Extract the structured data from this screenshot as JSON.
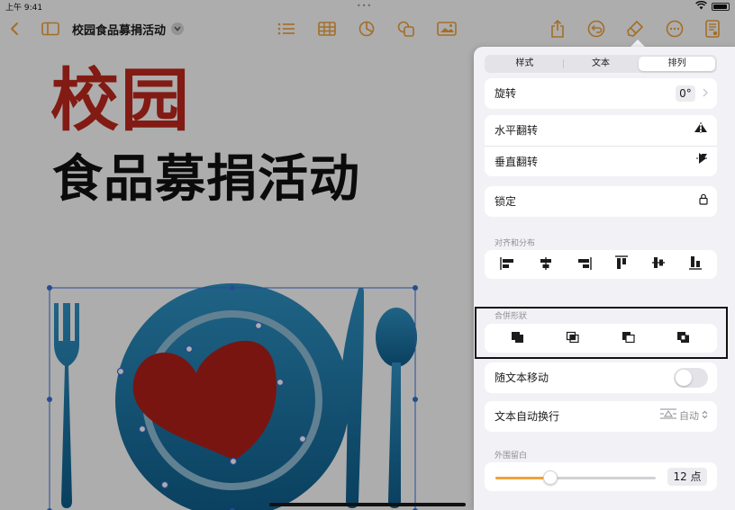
{
  "status_bar": {
    "time": "上午 9:41",
    "dots": "•••"
  },
  "toolbar": {
    "title": "校园食品募捐活动"
  },
  "slide": {
    "headline_1": "校园",
    "headline_2": "食品募捐活动"
  },
  "panel": {
    "tabs": [
      {
        "label": "样式",
        "active": false
      },
      {
        "label": "文本",
        "active": false
      },
      {
        "label": "排列",
        "active": true
      }
    ],
    "rotate": {
      "label": "旋转",
      "value": "0°"
    },
    "flip_horizontal": "水平翻转",
    "flip_vertical": "垂直翻转",
    "lock": "锁定",
    "align_distribute_label": "对齐和分布",
    "combine_shapes_label": "合併形狀",
    "move_with_text": {
      "label": "随文本移动",
      "on": false
    },
    "text_wrap": {
      "label": "文本自动换行",
      "value": "自动"
    },
    "outer_margin": {
      "label": "外围留白",
      "value": "12 点",
      "fraction": 0.34
    }
  },
  "colors": {
    "accent": "#f1a33a",
    "headline_red": "#c0281c",
    "plate_blue": "#1f77a8",
    "heart_red": "#b11f1a"
  },
  "icons": {
    "back": "chevron-left-icon",
    "sidebar": "sidebar-icon",
    "list": "list-icon",
    "table": "table-icon",
    "chart": "chart-icon",
    "shape": "shape-icon",
    "media": "media-icon",
    "share": "share-icon",
    "undo": "undo-icon",
    "format": "paintbrush-icon",
    "more": "more-icon",
    "document": "document-icon"
  }
}
